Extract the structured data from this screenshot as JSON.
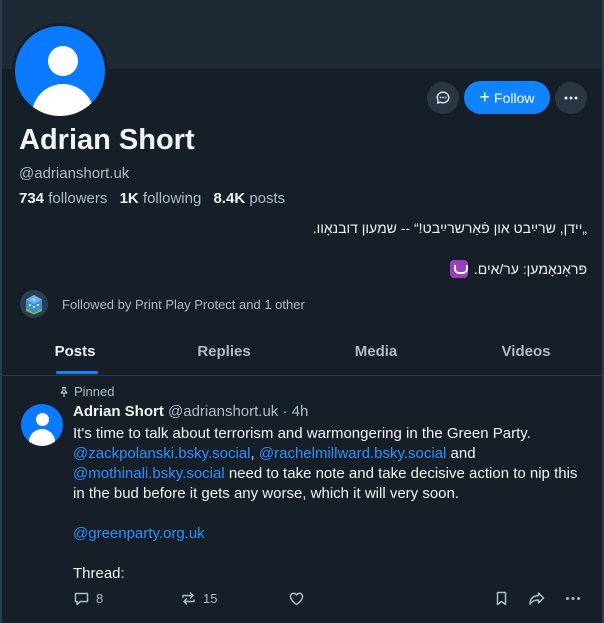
{
  "profile": {
    "name": "Adrian Short",
    "handle": "@adrianshort.uk",
    "followers_count": "734",
    "followers_label": "followers",
    "following_count": "1K",
    "following_label": "following",
    "posts_count": "8.4K",
    "posts_label": "posts",
    "bio_line1": "„יידן, שרײַבט און פֿאַרשרײַבט!“ -- שמעון דובנאָוו.",
    "bio_line2": "פּראָנאָמען: ער/אים.",
    "followed_by": "Followed by Print Play Protect and 1 other",
    "follow_label": "Follow"
  },
  "tabs": [
    {
      "label": "Posts",
      "active": true
    },
    {
      "label": "Replies",
      "active": false
    },
    {
      "label": "Media",
      "active": false
    },
    {
      "label": "Videos",
      "active": false
    }
  ],
  "post": {
    "pinned_label": "Pinned",
    "author_name": "Adrian Short",
    "author_meta": "@adrianshort.uk · 4h",
    "text_part1": "It's time to talk about terrorism and warmongering in the Green Party.",
    "mention1": "@zackpolanski.bsky.social",
    "sep1": ", ",
    "mention2": "@rachelmillward.bsky.social",
    "sep2": " and",
    "mention3": "@mothinali.bsky.social",
    "text_part2": " need to take note and take decisive action to nip this in the bud before it gets any worse, which it will very soon.",
    "mention4": "@greenparty.org.uk",
    "thread_label": "Thread:",
    "reply_count": "8",
    "repost_count": "15"
  },
  "colors": {
    "background": "#161e27",
    "accent": "#1083fe",
    "link": "#2e8fff",
    "muted_text": "#aebbc9"
  },
  "icons": [
    "message-icon",
    "plus-icon",
    "ellipsis-icon",
    "pin-icon",
    "reply-icon",
    "repost-icon",
    "like-heart-icon",
    "bookmark-icon",
    "share-icon"
  ]
}
